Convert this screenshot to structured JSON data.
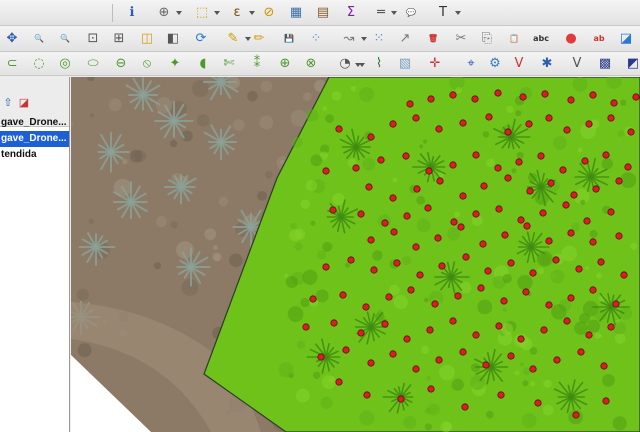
{
  "toolbar": {
    "row1": [
      {
        "name": "identify-features-icon",
        "glyph": "ℹ",
        "color": "#2a5db0"
      },
      {
        "name": "zoom-actual-icon",
        "glyph": "⊕",
        "color": "#666666"
      },
      {
        "name": "select-features-icon",
        "glyph": "⬚",
        "color": "#d4a017"
      },
      {
        "name": "select-expression-icon",
        "glyph": "ε",
        "color": "#7a4a00"
      },
      {
        "name": "deselect-all-icon",
        "glyph": "⊘",
        "color": "#d09000"
      },
      {
        "name": "attribute-table-icon",
        "glyph": "▦",
        "color": "#3a6ea5"
      },
      {
        "name": "field-calculator-icon",
        "glyph": "▤",
        "color": "#8a5a2a"
      },
      {
        "name": "statistical-summary-icon",
        "glyph": "Σ",
        "color": "#7b1fa2"
      },
      {
        "name": "measure-line-icon",
        "glyph": "═",
        "color": "#555555"
      },
      {
        "name": "map-tips-icon",
        "glyph": "💬",
        "color": "#e0c000"
      },
      {
        "name": "text-annotation-icon",
        "glyph": "T",
        "color": "#333333"
      }
    ],
    "row2": [
      {
        "name": "pan-map-icon",
        "glyph": "✥",
        "color": "#2a5db0"
      },
      {
        "name": "zoom-in-icon",
        "glyph": "🔍",
        "color": "#d4a017"
      },
      {
        "name": "zoom-out-icon",
        "glyph": "🔍",
        "color": "#d4a017"
      },
      {
        "name": "zoom-full-icon",
        "glyph": "⊡",
        "color": "#555555"
      },
      {
        "name": "zoom-selection-icon",
        "glyph": "⊞",
        "color": "#555555"
      },
      {
        "name": "zoom-layer-icon",
        "glyph": "◫",
        "color": "#d4a017"
      },
      {
        "name": "zoom-last-icon",
        "glyph": "◧",
        "color": "#555555"
      },
      {
        "name": "refresh-icon",
        "glyph": "⟳",
        "color": "#2a7ad0"
      },
      {
        "name": "current-edits-icon",
        "glyph": "✎",
        "color": "#c8a000"
      },
      {
        "name": "toggle-editing-icon",
        "glyph": "✏",
        "color": "#d4a017"
      },
      {
        "name": "save-edits-icon",
        "glyph": "💾",
        "color": "#666666"
      },
      {
        "name": "add-feature-icon",
        "glyph": "⁘",
        "color": "#5a8fd0"
      },
      {
        "name": "move-feature-icon",
        "glyph": "↝",
        "color": "#777777"
      },
      {
        "name": "node-tool-icon",
        "glyph": "⁙",
        "color": "#5a8fd0"
      },
      {
        "name": "digitize-icon",
        "glyph": "↗",
        "color": "#777777"
      },
      {
        "name": "delete-selected-icon",
        "glyph": "🗑",
        "color": "#cc3333"
      },
      {
        "name": "cut-features-icon",
        "glyph": "✂",
        "color": "#777777"
      },
      {
        "name": "copy-features-icon",
        "glyph": "⎘",
        "color": "#777777"
      },
      {
        "name": "paste-features-icon",
        "glyph": "📋",
        "color": "#777777"
      },
      {
        "name": "label-tool-icon",
        "glyph": "abc",
        "color": "#333333"
      },
      {
        "name": "layer-styling-icon",
        "glyph": "●",
        "color": "#e23b3b"
      },
      {
        "name": "label-settings-icon",
        "glyph": "ab",
        "color": "#cc3333"
      },
      {
        "name": "label-pin-icon",
        "glyph": "◪",
        "color": "#2a7ad0"
      }
    ],
    "row3": [
      {
        "name": "advanced-digitize-icon",
        "glyph": "⊂",
        "color": "#4c9a2a"
      },
      {
        "name": "add-ring-icon",
        "glyph": "◌",
        "color": "#4c9a2a"
      },
      {
        "name": "add-part-icon",
        "glyph": "◎",
        "color": "#4c9a2a"
      },
      {
        "name": "fill-ring-icon",
        "glyph": "⬭",
        "color": "#4c9a2a"
      },
      {
        "name": "delete-ring-icon",
        "glyph": "⊖",
        "color": "#4c9a2a"
      },
      {
        "name": "delete-part-icon",
        "glyph": "⦸",
        "color": "#4c9a2a"
      },
      {
        "name": "reshape-features-icon",
        "glyph": "✦",
        "color": "#4c9a2a"
      },
      {
        "name": "offset-curve-icon",
        "glyph": "◖",
        "color": "#4c9a2a"
      },
      {
        "name": "split-features-icon",
        "glyph": "✄",
        "color": "#4c9a2a"
      },
      {
        "name": "split-parts-icon",
        "glyph": "⁑",
        "color": "#4c9a2a"
      },
      {
        "name": "merge-selected-icon",
        "glyph": "⊕",
        "color": "#4c9a2a"
      },
      {
        "name": "merge-attributes-icon",
        "glyph": "⊗",
        "color": "#4c9a2a"
      },
      {
        "name": "rotate-point-icon",
        "glyph": "◔",
        "color": "#555555"
      },
      {
        "name": "simplify-feature-icon",
        "glyph": "⌇",
        "color": "#2a7a2a"
      },
      {
        "name": "digitize-shape-icon",
        "glyph": "▧",
        "color": "#7aa0c0"
      },
      {
        "name": "snapping-icon",
        "glyph": "✛",
        "color": "#cc3333"
      },
      {
        "name": "georeferencer-icon",
        "glyph": "⌖",
        "color": "#2a5db0"
      },
      {
        "name": "processing-toolbox-icon",
        "glyph": "⚙",
        "color": "#3a7ac0"
      },
      {
        "name": "vector-field-icon",
        "glyph": "V",
        "color": "#cc3333"
      },
      {
        "name": "graphical-modeler-icon",
        "glyph": "✱",
        "color": "#2a5db0"
      },
      {
        "name": "python-console-icon",
        "glyph": "V",
        "color": "#555555"
      },
      {
        "name": "checkerboard-icon",
        "glyph": "▩",
        "color": "#2a3a8a"
      },
      {
        "name": "raster-info-icon",
        "glyph": "◩",
        "color": "#2a3a8a"
      }
    ]
  },
  "layers_panel": {
    "tools": [
      {
        "name": "expand-layers-icon",
        "glyph": "⇧",
        "color": "#2a5db0"
      },
      {
        "name": "remove-layer-icon",
        "glyph": "◪",
        "color": "#cc3333"
      }
    ],
    "items": [
      {
        "label": "gave_Drone...",
        "selected": false
      },
      {
        "label": "gave_Drone...",
        "selected": true
      },
      {
        "label": "tendida",
        "selected": false
      }
    ]
  },
  "map": {
    "colors": {
      "soil": "#8c7a66",
      "grass": "#6fc21a",
      "grass_dark": "#4e9a12",
      "polygon_outline": "#2f3a2a",
      "marker_fill": "#d81f26",
      "marker_stroke": "#6a0a0a",
      "white_area": "#ffffff"
    },
    "layers": {
      "raster": "Agave drone orthophoto",
      "polygon": "study area polygon",
      "points": "agave plant markers"
    },
    "point_count": 136
  }
}
